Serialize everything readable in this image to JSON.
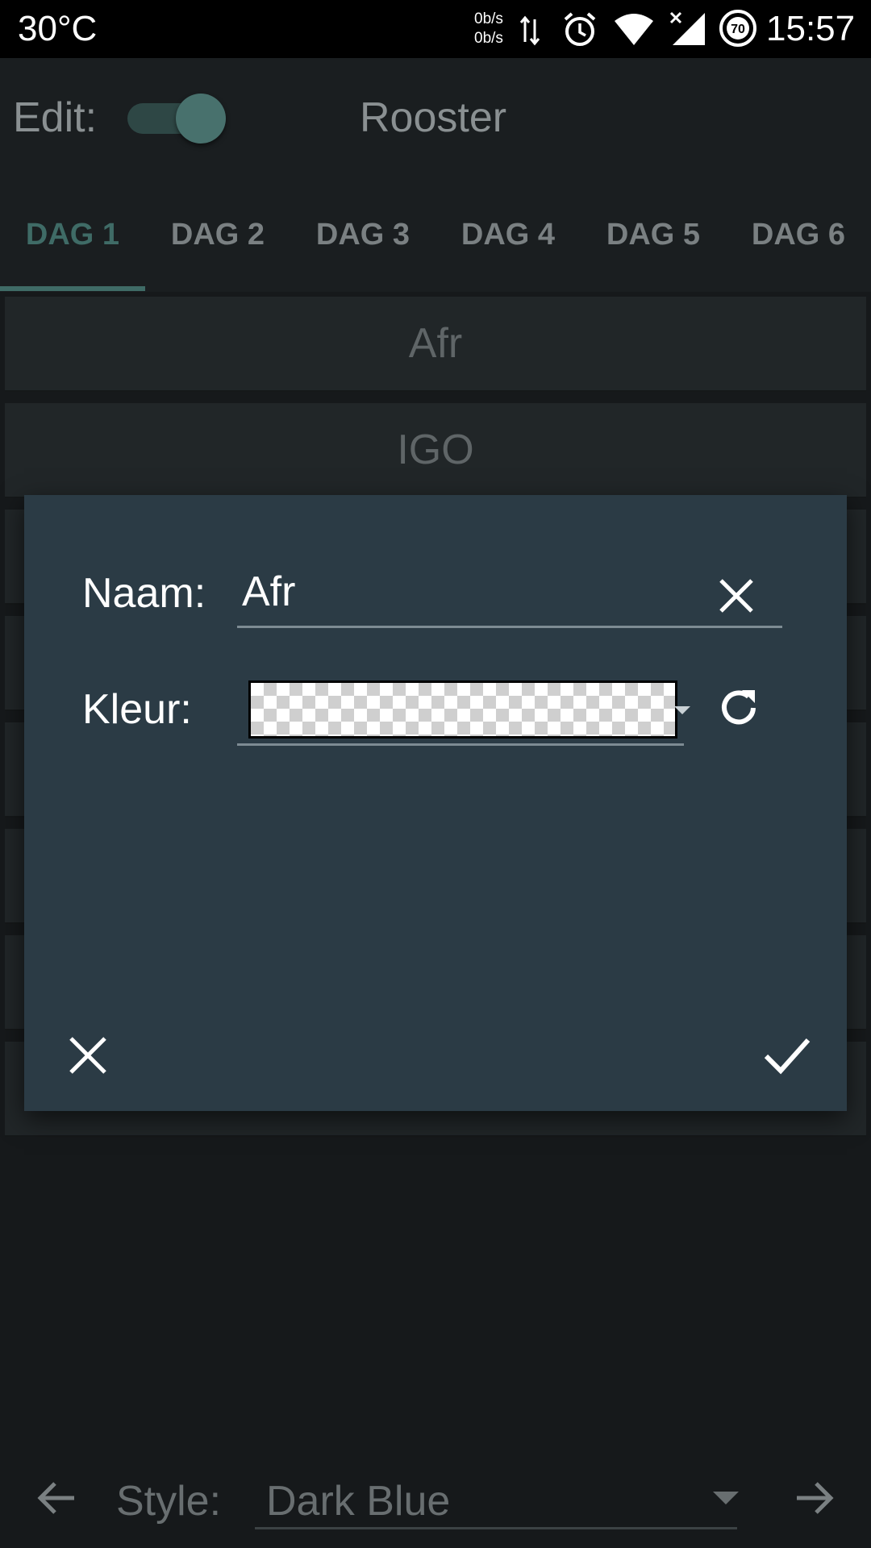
{
  "status_bar": {
    "temperature": "30°C",
    "net_up": "0b/s",
    "net_down": "0b/s",
    "battery_level": "70",
    "time": "15:57",
    "icons": [
      "data-transfer-icon",
      "alarm-icon",
      "wifi-icon",
      "signal-icon",
      "battery-icon"
    ]
  },
  "toolbar": {
    "edit_label": "Edit:",
    "edit_toggle_on": true,
    "title": "Rooster"
  },
  "tabs": [
    {
      "label": "DAG 1",
      "active": true
    },
    {
      "label": "DAG 2",
      "active": false
    },
    {
      "label": "DAG 3",
      "active": false
    },
    {
      "label": "DAG 4",
      "active": false
    },
    {
      "label": "DAG 5",
      "active": false
    },
    {
      "label": "DAG 6",
      "active": false
    }
  ],
  "rows": [
    {
      "label": "Afr"
    },
    {
      "label": "IGO"
    }
  ],
  "dialog": {
    "name_label": "Naam:",
    "name_value": "Afr",
    "color_label": "Kleur:",
    "color_value": "transparent",
    "icons": {
      "clear": "close-icon",
      "reset": "refresh-icon",
      "cancel": "close-icon",
      "confirm": "check-icon"
    }
  },
  "bottom_bar": {
    "style_label": "Style:",
    "style_value": "Dark Blue",
    "icons": {
      "prev": "arrow-left-icon",
      "next": "arrow-right-icon",
      "dropdown": "caret-down-icon"
    }
  },
  "colors": {
    "accent": "#3f6b66",
    "dialog_bg": "#2b3b45",
    "app_bg": "#16191b"
  }
}
